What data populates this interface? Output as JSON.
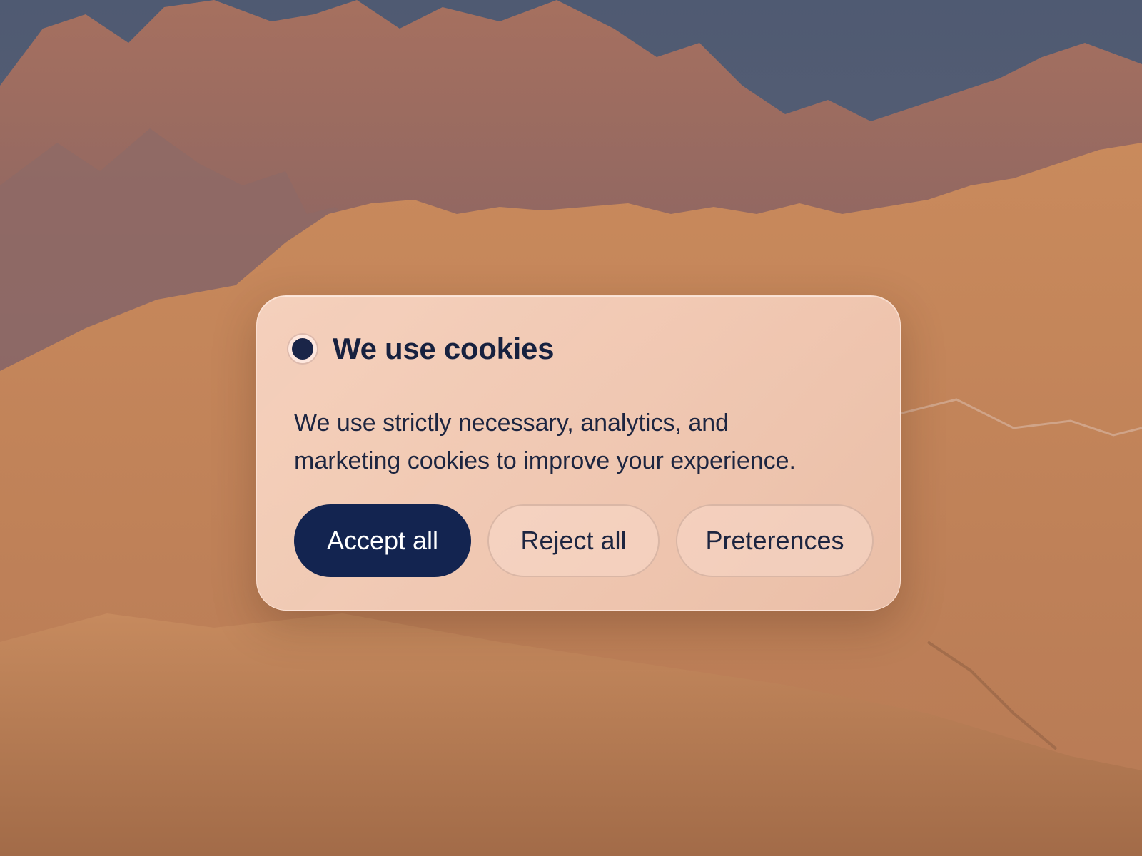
{
  "cookie_banner": {
    "title": "We use cookies",
    "description_line1": "We use strictly necessary, analytics, and",
    "description_line2": "marketing cookies to improve your experience.",
    "buttons": {
      "accept_label": "Accept all",
      "reject_label": "Reject all",
      "preferences_label": "Preterences"
    }
  },
  "colors": {
    "accent": "#132450",
    "title_text": "#17213f",
    "card_background": "#f4ceba"
  },
  "icons": {
    "status_dot": "dot-icon"
  }
}
